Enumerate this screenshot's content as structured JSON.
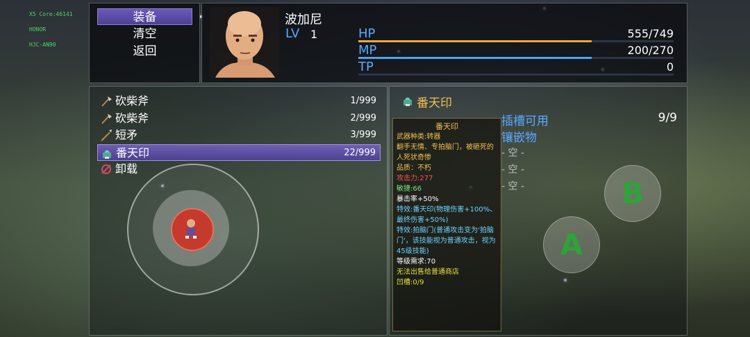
{
  "debug": {
    "line1": "X5 Core:46141",
    "line2": "HONOR",
    "line3": "HJC-AN90"
  },
  "commands": [
    {
      "label": "装备",
      "selected": true
    },
    {
      "label": "清空",
      "selected": false
    },
    {
      "label": "返回",
      "selected": false
    }
  ],
  "actor": {
    "name": "波加尼",
    "level_label": "LV",
    "level": "1"
  },
  "gauges": [
    {
      "label": "HP",
      "value": "555/749",
      "current": 555,
      "max": 749,
      "color": "#f0a83a"
    },
    {
      "label": "MP",
      "value": "200/270",
      "current": 200,
      "max": 270,
      "color": "#4aa6f0"
    },
    {
      "label": "TP",
      "value": "0",
      "current": 0,
      "max": 100,
      "color": "#46c070"
    }
  ],
  "items": [
    {
      "name": "砍柴斧",
      "qty": "1/999",
      "icon": "axe-icon",
      "selected": false
    },
    {
      "name": "砍柴斧",
      "qty": "2/999",
      "icon": "axe-icon",
      "selected": false
    },
    {
      "name": "短矛",
      "qty": "3/999",
      "icon": "spear-icon",
      "selected": false
    },
    {
      "name": "番天印",
      "qty": "22/999",
      "icon": "seal-icon",
      "selected": true
    },
    {
      "name": "卸载",
      "qty": "",
      "icon": "unequip-icon",
      "selected": false
    }
  ],
  "detail": {
    "header": "番天印",
    "slot_label": "插槽可用",
    "slot_value": "9/9",
    "inlay_label": "镶嵌物",
    "slots": [
      "- 空 -",
      "- 空 -",
      "- 空 -"
    ]
  },
  "tooltip": {
    "title": "番天印",
    "type": "武器种类:转器",
    "desc": "翻手无情、专拍脑门，被砸死的人死状奇惨",
    "quality": "品质：不朽",
    "attack": "攻击力:277",
    "agility": "敏捷:66",
    "crit": "暴击率+50%",
    "effect1": "特效:番天印(物理伤害+100%、最终伤害+50%)",
    "effect2": "特效:拍脑门(普通攻击变为'拍脑门'，该技能视为普通攻击，视为45级技能)",
    "level_req": "等级需求:70",
    "nosell": "无法出售给普通商店",
    "socket": "凹槽:0/9",
    "colors": {
      "attack": "#ff5050",
      "agility": "#7fe07f",
      "effect": "#6fd3ff",
      "nosell": "#e0e040",
      "title": "#f0c050"
    }
  },
  "controls": {
    "a_label": "A",
    "b_label": "B"
  }
}
